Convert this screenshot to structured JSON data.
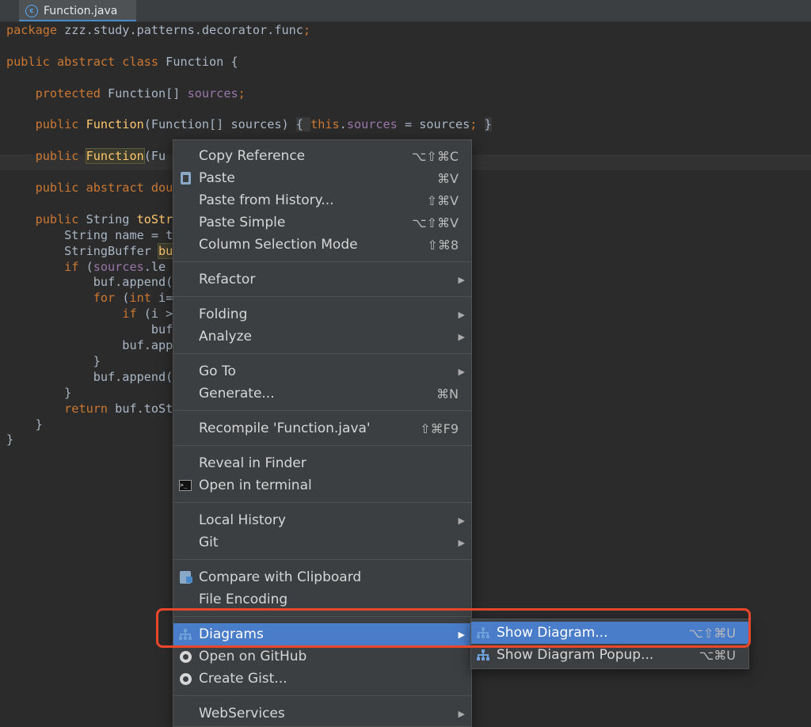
{
  "tab": {
    "icon": "java-class-icon",
    "icon_letter": "c",
    "title": "Function.java"
  },
  "code": [
    [
      {
        "t": "package ",
        "c": "kw"
      },
      {
        "t": "zzz.study.patterns.decorator.func",
        "c": ""
      },
      {
        "t": ";",
        "c": "kw"
      }
    ],
    [],
    [
      {
        "t": "public abstract class ",
        "c": "kw"
      },
      {
        "t": "Function {",
        "c": ""
      }
    ],
    [],
    [
      {
        "t": "    protected ",
        "c": "kw"
      },
      {
        "t": "Function[] ",
        "c": ""
      },
      {
        "t": "sources",
        "c": "fld"
      },
      {
        "t": ";",
        "c": "kw"
      }
    ],
    [],
    [
      {
        "t": "    public ",
        "c": "kw"
      },
      {
        "t": "Function",
        "c": "fn"
      },
      {
        "t": "(Function[] sources) ",
        "c": ""
      },
      {
        "t": "{ ",
        "c": "brace"
      },
      {
        "t": "this",
        "c": "kw"
      },
      {
        "t": ".",
        "c": ""
      },
      {
        "t": "sources",
        "c": "fld"
      },
      {
        "t": " = sources",
        "c": ""
      },
      {
        "t": "; ",
        "c": "kw"
      },
      {
        "t": "}",
        "c": "brace"
      }
    ],
    [],
    [
      {
        "t": "    public ",
        "c": "kw"
      },
      {
        "t": "Function",
        "c": "hl"
      },
      {
        "t": "(Fu",
        "c": ""
      }
    ],
    [],
    [
      {
        "t": "    public abstract ",
        "c": "kw"
      },
      {
        "t": "dou",
        "c": "kw"
      }
    ],
    [],
    [
      {
        "t": "    public ",
        "c": "kw"
      },
      {
        "t": "String ",
        "c": ""
      },
      {
        "t": "toStr",
        "c": "fn"
      }
    ],
    [
      {
        "t": "        String name = t",
        "c": ""
      }
    ],
    [
      {
        "t": "        StringBuffer ",
        "c": ""
      },
      {
        "t": "bu",
        "c": "hl"
      }
    ],
    [
      {
        "t": "        ",
        "c": ""
      },
      {
        "t": "if ",
        "c": "kw"
      },
      {
        "t": "(",
        "c": ""
      },
      {
        "t": "sources",
        "c": "fld"
      },
      {
        "t": ".le",
        "c": ""
      }
    ],
    [
      {
        "t": "            buf.append(",
        "c": ""
      }
    ],
    [
      {
        "t": "            ",
        "c": ""
      },
      {
        "t": "for ",
        "c": "kw"
      },
      {
        "t": "(",
        "c": ""
      },
      {
        "t": "int ",
        "c": "kw"
      },
      {
        "t": "i=",
        "c": ""
      }
    ],
    [
      {
        "t": "                ",
        "c": ""
      },
      {
        "t": "if ",
        "c": "kw"
      },
      {
        "t": "(i >",
        "c": ""
      }
    ],
    [
      {
        "t": "                    buf",
        "c": ""
      }
    ],
    [
      {
        "t": "                buf.app",
        "c": ""
      }
    ],
    [
      {
        "t": "            }",
        "c": ""
      }
    ],
    [
      {
        "t": "            buf.append(",
        "c": ""
      }
    ],
    [
      {
        "t": "        }",
        "c": ""
      }
    ],
    [
      {
        "t": "        ",
        "c": ""
      },
      {
        "t": "return ",
        "c": "kw"
      },
      {
        "t": "buf.toSt",
        "c": ""
      }
    ],
    [
      {
        "t": "    }",
        "c": ""
      }
    ],
    [
      {
        "t": "}",
        "c": ""
      }
    ]
  ],
  "menu": {
    "items": [
      {
        "label": "Copy Reference",
        "shortcut": "⌥⇧⌘C",
        "icon": "",
        "submenu": false
      },
      {
        "label": "Paste",
        "shortcut": "⌘V",
        "icon": "paste-icon",
        "submenu": false
      },
      {
        "label": "Paste from History...",
        "shortcut": "⇧⌘V",
        "icon": "",
        "submenu": false
      },
      {
        "label": "Paste Simple",
        "shortcut": "⌥⇧⌘V",
        "icon": "",
        "submenu": false
      },
      {
        "label": "Column Selection Mode",
        "shortcut": "⇧⌘8",
        "icon": "",
        "submenu": false,
        "sep_after": true
      },
      {
        "label": "Refactor",
        "shortcut": "",
        "icon": "",
        "submenu": true,
        "sep_after": true
      },
      {
        "label": "Folding",
        "shortcut": "",
        "icon": "",
        "submenu": true
      },
      {
        "label": "Analyze",
        "shortcut": "",
        "icon": "",
        "submenu": true,
        "sep_after": true
      },
      {
        "label": "Go To",
        "shortcut": "",
        "icon": "",
        "submenu": true
      },
      {
        "label": "Generate...",
        "shortcut": "⌘N",
        "icon": "",
        "submenu": false,
        "sep_after": true
      },
      {
        "label": "Recompile 'Function.java'",
        "shortcut": "⇧⌘F9",
        "icon": "",
        "submenu": false,
        "sep_after": true
      },
      {
        "label": "Reveal in Finder",
        "shortcut": "",
        "icon": "",
        "submenu": false
      },
      {
        "label": "Open in terminal",
        "shortcut": "",
        "icon": "terminal-icon",
        "submenu": false,
        "sep_after": true
      },
      {
        "label": "Local History",
        "shortcut": "",
        "icon": "",
        "submenu": true
      },
      {
        "label": "Git",
        "shortcut": "",
        "icon": "",
        "submenu": true,
        "sep_after": true
      },
      {
        "label": "Compare with Clipboard",
        "shortcut": "",
        "icon": "compare-icon",
        "submenu": false
      },
      {
        "label": "File Encoding",
        "shortcut": "",
        "icon": "",
        "submenu": false,
        "sep_after": true
      },
      {
        "label": "Diagrams",
        "shortcut": "",
        "icon": "diagram-icon",
        "submenu": true,
        "selected": true
      },
      {
        "label": "Open on GitHub",
        "shortcut": "",
        "icon": "github-icon",
        "submenu": false
      },
      {
        "label": "Create Gist...",
        "shortcut": "",
        "icon": "github-icon",
        "submenu": false,
        "sep_after": true
      },
      {
        "label": "WebServices",
        "shortcut": "",
        "icon": "",
        "submenu": true
      }
    ]
  },
  "submenu": {
    "items": [
      {
        "label": "Show Diagram...",
        "shortcut": "⌥⇧⌘U",
        "icon": "diagram-icon",
        "selected": true
      },
      {
        "label": "Show Diagram Popup...",
        "shortcut": "⌥⌘U",
        "icon": "diagram-icon",
        "selected": false
      }
    ]
  },
  "colors": {
    "highlight_box": "#e9462c",
    "selection": "#4a7dc9",
    "menu_bg": "#3c3f41",
    "editor_bg": "#2b2b2b"
  }
}
